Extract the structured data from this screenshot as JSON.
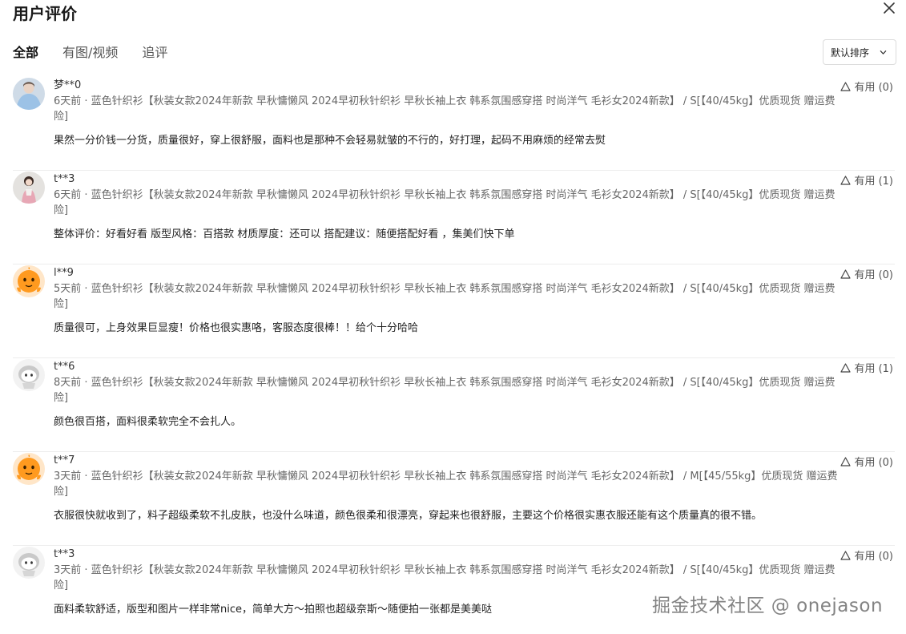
{
  "header": {
    "title": "用户评价"
  },
  "tabs": [
    {
      "label": "全部",
      "active": true
    },
    {
      "label": "有图/视频",
      "active": false
    },
    {
      "label": "追评",
      "active": false
    }
  ],
  "sort": {
    "label": "默认排序"
  },
  "reviews": [
    {
      "user": "梦**0",
      "meta": "6天前 · 蓝色针织衫【秋装女款2024年新款 早秋慵懒风 2024早初秋针织衫 早秋长袖上衣 韩系氛围感穿搭 时尚洋气 毛衫女2024新款】 / S[【40/45kg】优质现货 赠运费险]",
      "content": "果然一分价钱一分货，质量很好，穿上很舒服，面料也是那种不会轻易就皱的不行的，好打理，起码不用麻烦的经常去熨",
      "useful": "有用 (0)",
      "avatar": "avatar-blue-sweater"
    },
    {
      "user": "t**3",
      "meta": "6天前 · 蓝色针织衫【秋装女款2024年新款 早秋慵懒风 2024早初秋针织衫 早秋长袖上衣 韩系氛围感穿搭 时尚洋气 毛衫女2024新款】 / S[【40/45kg】优质现货 赠运费险]",
      "content": "整体评价：好看好看 版型风格：百搭款 材质厚度：还可以 搭配建议：随便搭配好看 ，集美们快下单",
      "useful": "有用 (1)",
      "avatar": "avatar-girl-photo"
    },
    {
      "user": "l**9",
      "meta": "5天前 · 蓝色针织衫【秋装女款2024年新款 早秋慵懒风 2024早初秋针织衫 早秋长袖上衣 韩系氛围感穿搭 时尚洋气 毛衫女2024新款】 / S[【40/45kg】优质现货 赠运费险]",
      "content": "质量很可，上身效果巨显瘦！价格也很实惠咯，客服态度很棒！！给个十分哈哈",
      "useful": "有用 (0)",
      "avatar": "avatar-orange-mascot"
    },
    {
      "user": "t**6",
      "meta": "8天前 · 蓝色针织衫【秋装女款2024年新款 早秋慵懒风 2024早初秋针织衫 早秋长袖上衣 韩系氛围感穿搭 时尚洋气 毛衫女2024新款】 / S[【40/45kg】优质现货 赠运费险]",
      "content": "颜色很百搭，面料很柔软完全不会扎人。",
      "useful": "有用 (1)",
      "avatar": "avatar-gray-mascot"
    },
    {
      "user": "t**7",
      "meta": "3天前 · 蓝色针织衫【秋装女款2024年新款 早秋慵懒风 2024早初秋针织衫 早秋长袖上衣 韩系氛围感穿搭 时尚洋气 毛衫女2024新款】 / M[【45/55kg】优质现货 赠运费险]",
      "content": "衣服很快就收到了，料子超级柔软不扎皮肤，也没什么味道，颜色很柔和很漂亮，穿起来也很舒服，主要这个价格很实惠衣服还能有这个质量真的很不错。",
      "useful": "有用 (0)",
      "avatar": "avatar-orange-mascot"
    },
    {
      "user": "t**3",
      "meta": "3天前 · 蓝色针织衫【秋装女款2024年新款 早秋慵懒风 2024早初秋针织衫 早秋长袖上衣 韩系氛围感穿搭 时尚洋气 毛衫女2024新款】 / S[【40/45kg】优质现货 赠运费险]",
      "content": "面料柔软舒适，版型和图片一样非常nice，简单大方～拍照也超级奈斯～随便拍一张都是美美哒",
      "useful": "有用 (0)",
      "avatar": "avatar-gray-mascot"
    }
  ],
  "watermark": "掘金技术社区 @ onejason"
}
